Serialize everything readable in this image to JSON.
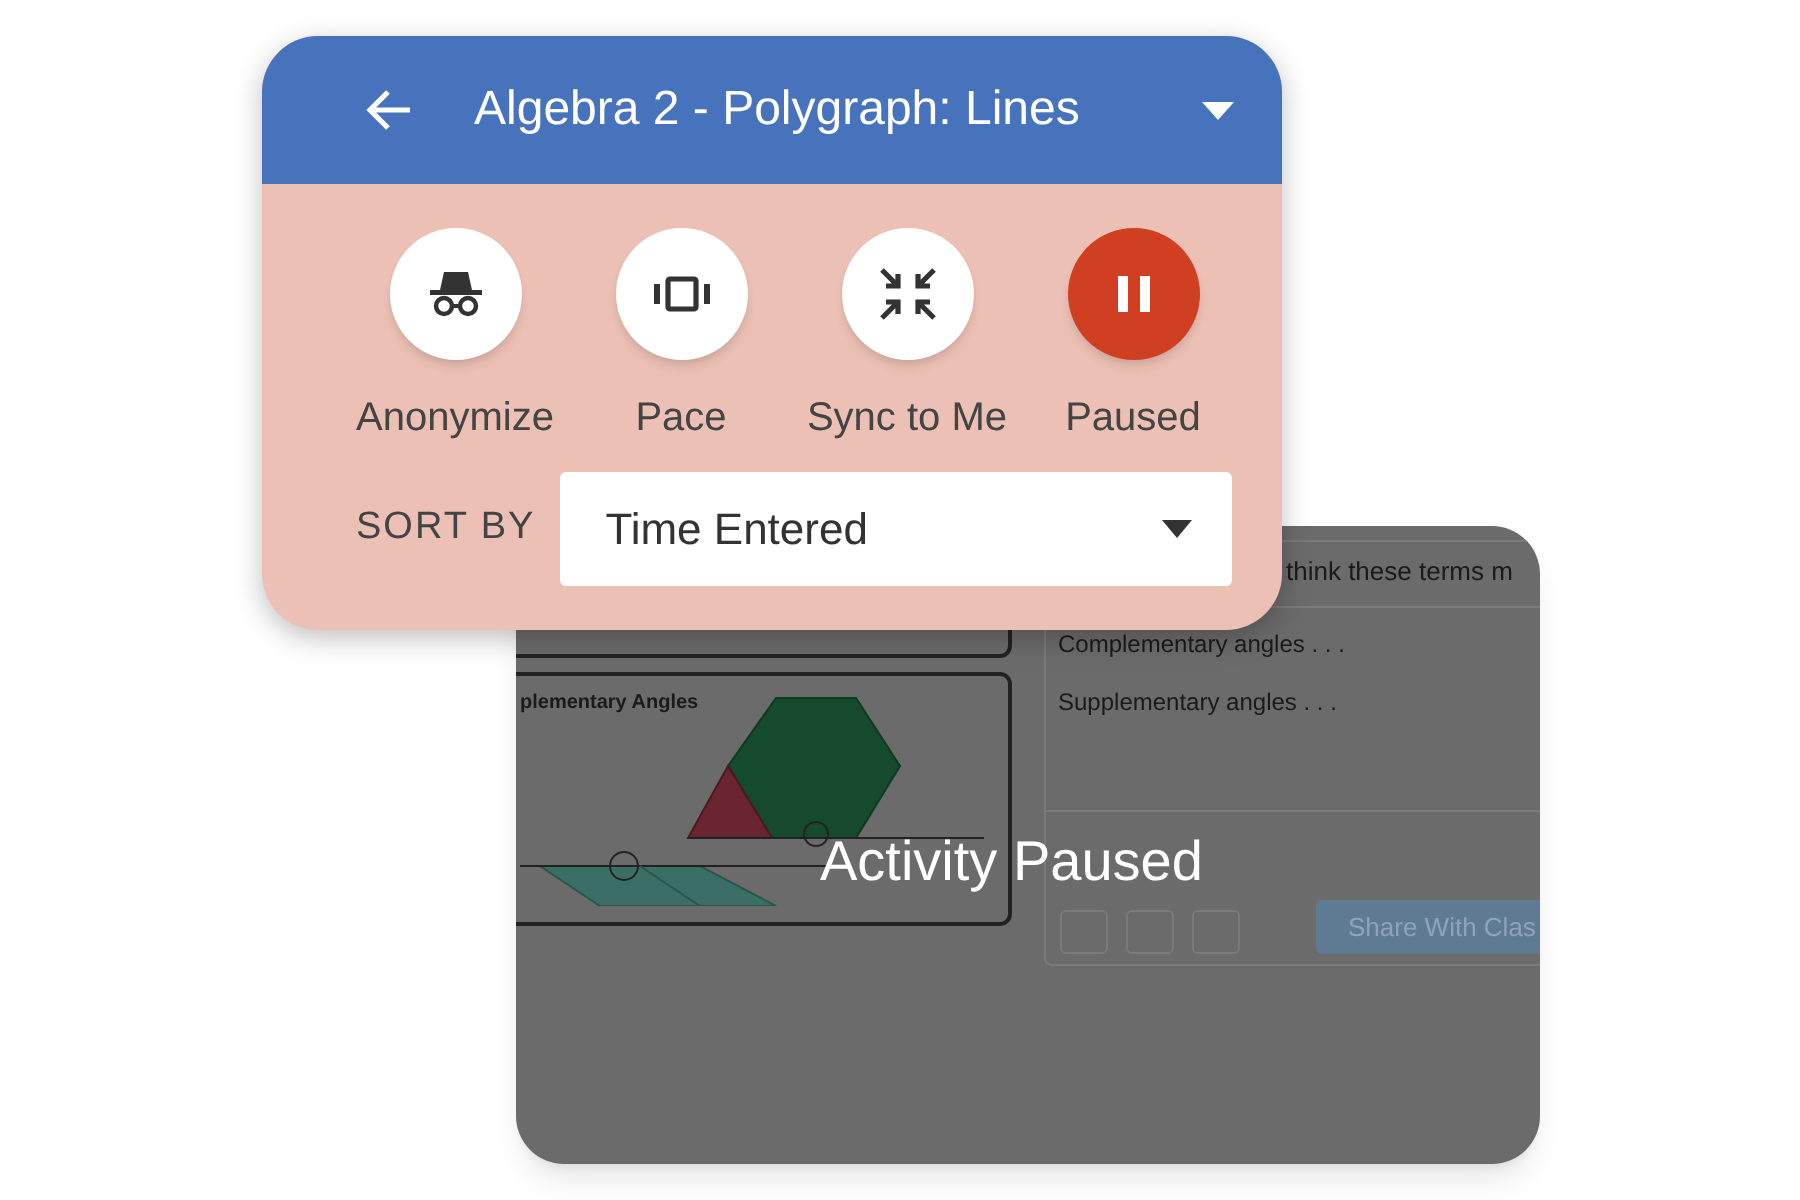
{
  "header": {
    "title": "Algebra 2 - Polygraph: Lines"
  },
  "controls": [
    {
      "label": "Anonymize",
      "kind": "anonymize",
      "on": false
    },
    {
      "label": "Pace",
      "kind": "pace",
      "on": false
    },
    {
      "label": "Sync to Me",
      "kind": "sync",
      "on": false
    },
    {
      "label": "Paused",
      "kind": "pause",
      "on": true
    }
  ],
  "sort": {
    "label": "SORT BY",
    "value": "Time Entered"
  },
  "paused_screen": {
    "card_title": "plementary Angles",
    "prompt": "think these terms m",
    "lines": [
      "Complementary angles . . .",
      "Supplementary angles . . ."
    ],
    "share_button": "Share With Clas",
    "overlay": "Activity Paused"
  }
}
